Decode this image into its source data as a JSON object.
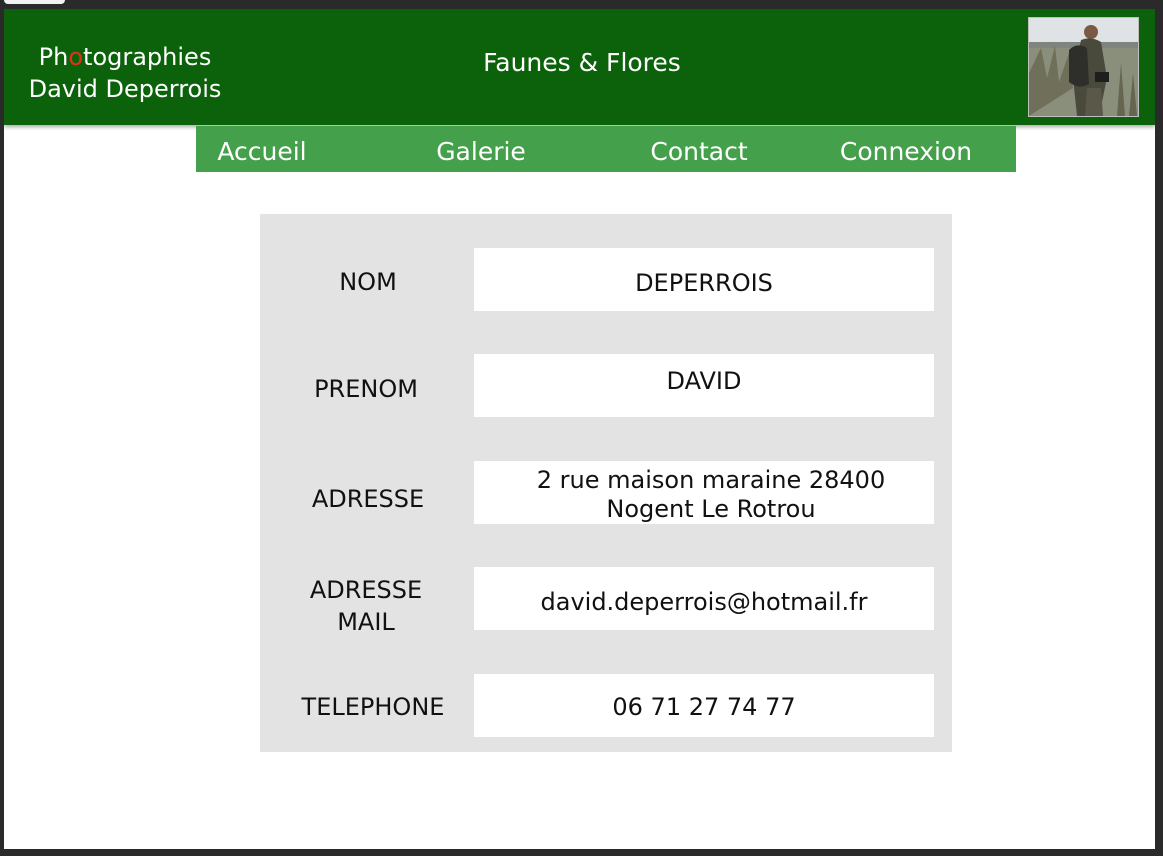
{
  "header": {
    "brand_line1_pre": "Ph",
    "brand_line1_accent": "o",
    "brand_line1_post": "tographies",
    "brand_line2": "David Deperrois",
    "site_title": "Faunes & Flores",
    "accent_color": "#e2301b",
    "background_color": "#0c620b"
  },
  "nav": {
    "background_color": "#45a04c",
    "items": [
      {
        "label": "Accueil"
      },
      {
        "label": "Galerie"
      },
      {
        "label": "Contact"
      },
      {
        "label": "Connexion"
      }
    ]
  },
  "profile": {
    "fields": [
      {
        "label": "NOM",
        "value": "DEPERROIS"
      },
      {
        "label": "PRENOM",
        "value": "DAVID"
      },
      {
        "label": "ADRESSE",
        "value": "2 rue maison maraine 28400 Nogent Le Rotrou"
      },
      {
        "label": "ADRESSE MAIL",
        "value": "david.deperrois@hotmail.fr"
      },
      {
        "label": "TELEPHONE",
        "value": "06 71 27 74 77"
      }
    ]
  }
}
